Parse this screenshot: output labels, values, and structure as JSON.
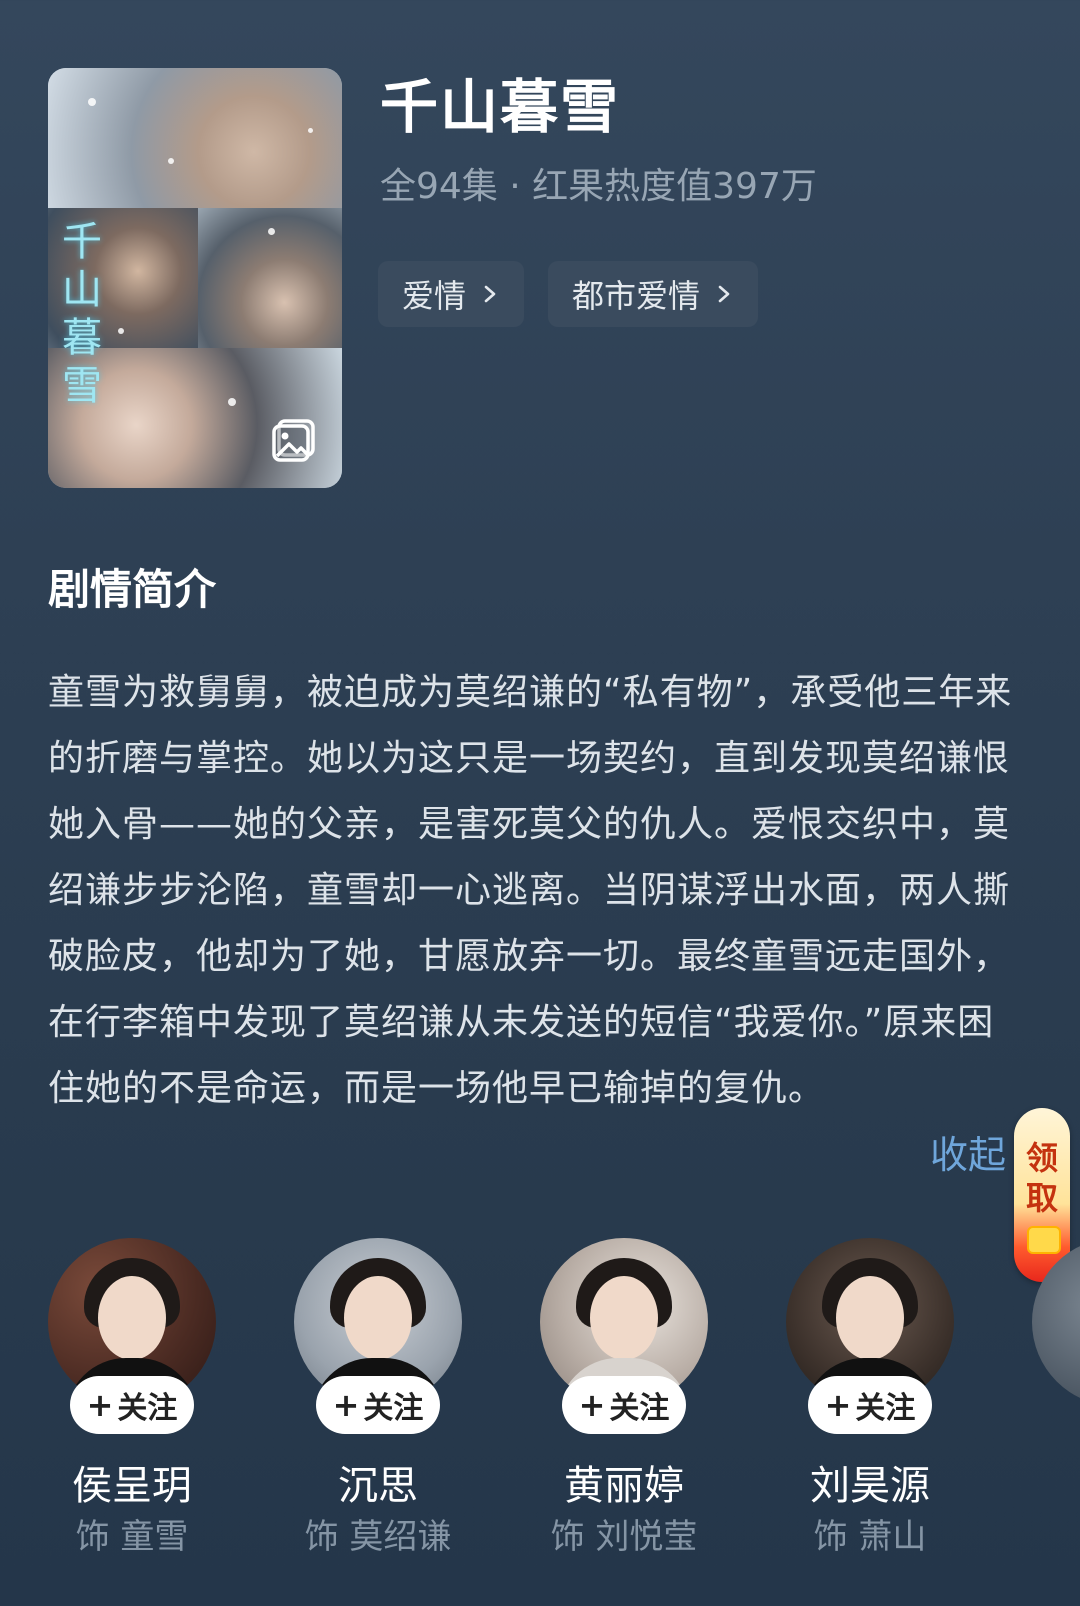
{
  "show": {
    "title": "千山暮雪",
    "meta": "全94集 · 红果热度值397万",
    "poster_title": "千山暮雪",
    "tags": [
      {
        "label": "爱情"
      },
      {
        "label": "都市爱情"
      }
    ]
  },
  "synopsis": {
    "heading": "剧情简介",
    "text": "童雪为救舅舅，被迫成为莫绍谦的“私有物”，承受他三年来的折磨与掌控。她以为这只是一场契约，直到发现莫绍谦恨她入骨——她的父亲，是害死莫父的仇人。爱恨交织中，莫绍谦步步沦陷，童雪却一心逃离。当阴谋浮出水面，两人撕破脸皮，他却为了她，甘愿放弃一切。最终童雪远走国外，在行李箱中发现了莫绍谦从未发送的短信“我爱你。”原来困住她的不是命运，而是一场他早已输掉的复仇。",
    "collapse_label": "收起"
  },
  "reward": {
    "label": "领取"
  },
  "cast": {
    "follow_label": "关注",
    "members": [
      {
        "name": "侯呈玥",
        "role": "饰 童雪"
      },
      {
        "name": "沉思",
        "role": "饰 莫绍谦"
      },
      {
        "name": "黄丽婷",
        "role": "饰 刘悦莹"
      },
      {
        "name": "刘昊源",
        "role": "饰 萧山"
      }
    ]
  },
  "colors": {
    "background": "#2d3f53",
    "accent_link": "#6fa6db",
    "tag_bg": "#3a4b5e",
    "secondary_text": "#98a6b4"
  },
  "icons": {
    "poster_gallery": "gallery-icon",
    "tag_chevron": "chevron-right-icon",
    "follow_plus": "plus-icon"
  }
}
